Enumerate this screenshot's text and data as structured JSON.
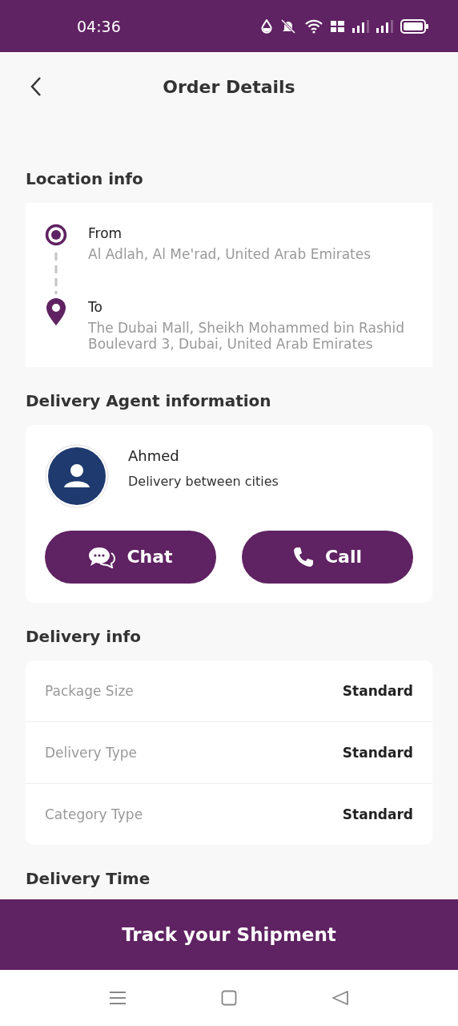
{
  "status_bar": {
    "time": "04:36"
  },
  "header": {
    "title": "Order Details"
  },
  "location": {
    "title": "Location info",
    "stops": [
      {
        "kind": "origin",
        "label": "From",
        "address": "Al Adlah, Al Me'rad, United Arab Emirates"
      },
      {
        "kind": "destination",
        "label": "To",
        "address": "The Dubai Mall, Sheikh Mohammed bin Rashid Boulevard 3, Dubai, United Arab Emirates"
      }
    ]
  },
  "agent": {
    "title": "Delivery Agent information",
    "name": "Ahmed",
    "service": "Delivery between cities",
    "buttons": [
      {
        "kind": "chat",
        "label": "Chat"
      },
      {
        "kind": "call",
        "label": "Call"
      }
    ]
  },
  "delivery": {
    "title": "Delivery info",
    "rows": [
      {
        "label": "Package Size",
        "value": "Standard"
      },
      {
        "label": "Delivery Type",
        "value": "Standard"
      },
      {
        "label": "Category Type",
        "value": "Standard"
      }
    ]
  },
  "next_section": {
    "title": "Delivery Time"
  },
  "primary_button": {
    "label": "Track your Shipment"
  }
}
